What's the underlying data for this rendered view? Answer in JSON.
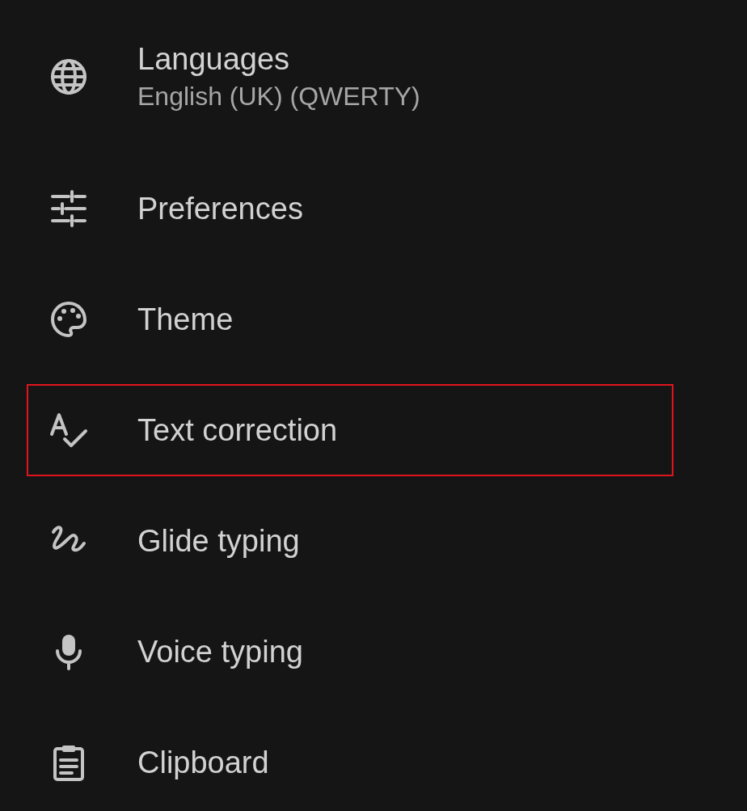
{
  "settings_items": [
    {
      "kind": "globe",
      "title": "Languages",
      "subtitle": "English (UK) (QWERTY)",
      "highlighted": false
    },
    {
      "kind": "tune",
      "title": "Preferences",
      "highlighted": false
    },
    {
      "kind": "palette",
      "title": "Theme",
      "highlighted": false
    },
    {
      "kind": "spellcheck",
      "title": "Text correction",
      "highlighted": true
    },
    {
      "kind": "gesture",
      "title": "Glide typing",
      "highlighted": false
    },
    {
      "kind": "mic",
      "title": "Voice typing",
      "highlighted": false
    },
    {
      "kind": "clipboard",
      "title": "Clipboard",
      "highlighted": false
    }
  ]
}
